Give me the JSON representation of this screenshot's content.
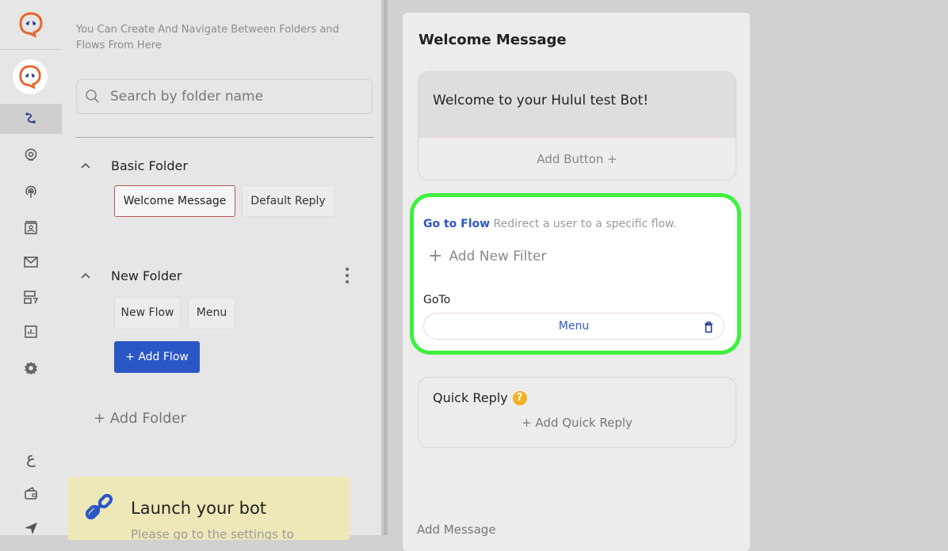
{
  "sidebar": {
    "nav_icons": [
      "flow-icon",
      "bot-settings-icon",
      "broadcast-icon",
      "contacts-icon",
      "inbox-icon",
      "templates-icon",
      "analytics-icon",
      "settings-icon"
    ],
    "bottom_icons": [
      "language-icon",
      "wallet-icon",
      "send-icon"
    ],
    "language_glyph": "ع"
  },
  "panel": {
    "hint": "You Can Create And Navigate Between Folders and Flows From Here",
    "search_placeholder": "Search by folder name",
    "folders": [
      {
        "name": "Basic Folder",
        "flows": [
          "Welcome Message",
          "Default Reply"
        ],
        "selected": "Welcome Message"
      },
      {
        "name": "New Folder",
        "flows": [
          "New Flow",
          "Menu"
        ],
        "add_flow_label": "+ Add Flow"
      }
    ],
    "add_folder_label": "+ Add Folder",
    "launch": {
      "title": "Launch your bot",
      "subtitle": "Please go to the settings to"
    }
  },
  "editor": {
    "title": "Welcome Message",
    "message_text": "Welcome to your Hulul test Bot!",
    "add_button_label": "Add Button +",
    "goto": {
      "link_label": "Go to Flow",
      "description": "Redirect a user to a specific flow.",
      "add_filter_label": "Add New Filter",
      "field_label": "GoTo",
      "selected_flow": "Menu"
    },
    "quick_reply": {
      "label": "Quick Reply",
      "help_glyph": "?",
      "add_label": "+ Add Quick Reply"
    },
    "add_message_label": "Add Message"
  },
  "colors": {
    "accent": "#2a56c6",
    "brand": "#e8632b",
    "highlight": "#3ef03e",
    "help": "#f0b324"
  }
}
